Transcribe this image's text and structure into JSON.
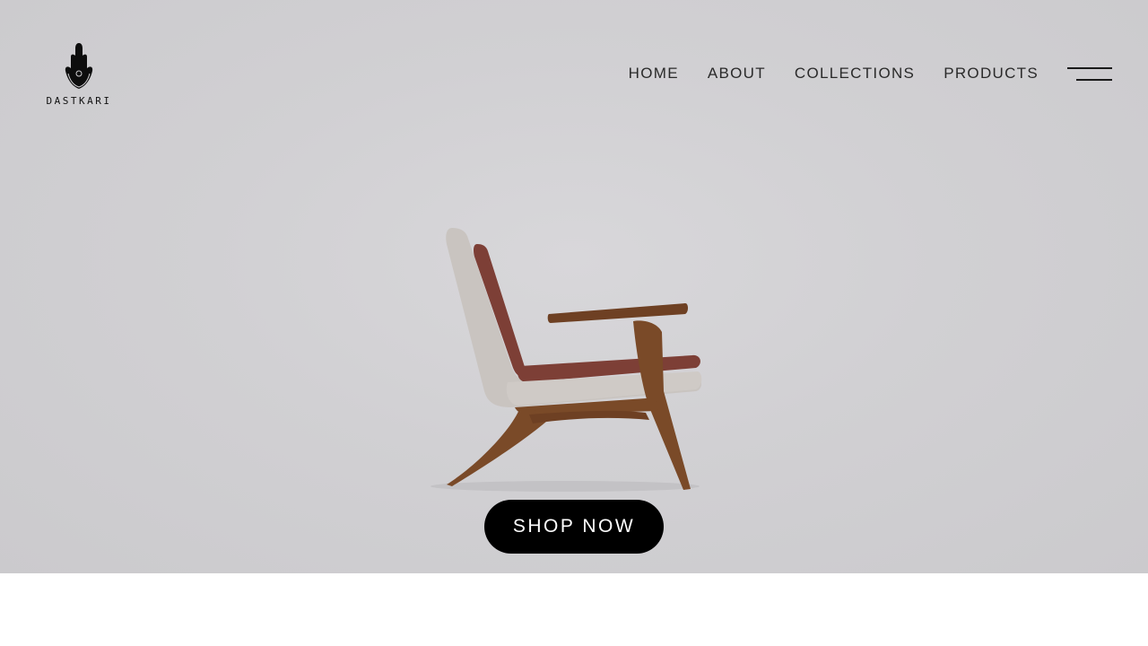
{
  "brand": {
    "name": "DASTKARI",
    "logo_icon": "hamsa-hand-icon"
  },
  "nav": {
    "items": [
      {
        "label": "HOME"
      },
      {
        "label": "ABOUT"
      },
      {
        "label": "COLLECTIONS"
      },
      {
        "label": "PRODUCTS"
      }
    ],
    "menu_icon": "hamburger-menu-icon"
  },
  "hero": {
    "image": "lounge-chair-photo",
    "cta_label": "SHOP NOW"
  },
  "colors": {
    "hero_background": "#d0cfd2",
    "cta_background": "#000000",
    "cta_text": "#ffffff",
    "nav_text": "#2a2a2a",
    "chair_wood": "#7a4a28",
    "chair_cushion": "#7d3f36",
    "chair_shell": "#c8c3bf"
  }
}
